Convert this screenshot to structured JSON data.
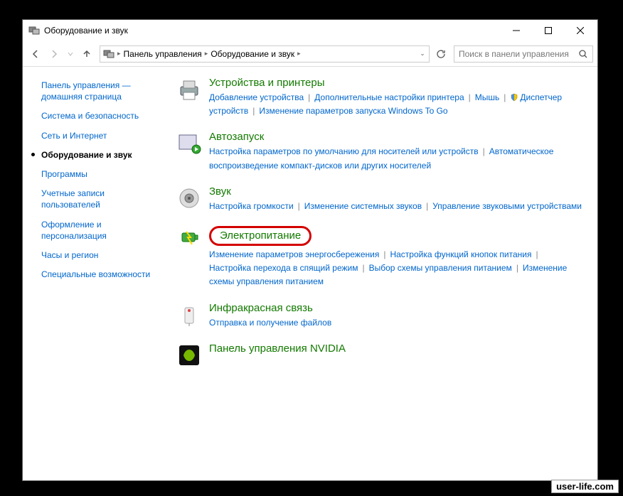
{
  "window": {
    "title": "Оборудование и звук"
  },
  "breadcrumb": {
    "root": "Панель управления",
    "current": "Оборудование и звук"
  },
  "search": {
    "placeholder": "Поиск в панели управления"
  },
  "sidebar": [
    {
      "label": "Панель управления — домашняя страница",
      "active": false
    },
    {
      "label": "Система и безопасность",
      "active": false
    },
    {
      "label": "Сеть и Интернет",
      "active": false
    },
    {
      "label": "Оборудование и звук",
      "active": true
    },
    {
      "label": "Программы",
      "active": false
    },
    {
      "label": "Учетные записи пользователей",
      "active": false
    },
    {
      "label": "Оформление и персонализация",
      "active": false
    },
    {
      "label": "Часы и регион",
      "active": false
    },
    {
      "label": "Специальные возможности",
      "active": false
    }
  ],
  "categories": [
    {
      "icon": "printer",
      "title": "Устройства и принтеры",
      "highlight": false,
      "links": [
        {
          "label": "Добавление устройства",
          "shield": false
        },
        {
          "label": "Дополнительные настройки принтера",
          "shield": false
        },
        {
          "label": "Мышь",
          "shield": false
        },
        {
          "label": "Диспетчер устройств",
          "shield": true
        },
        {
          "label": "Изменение параметров запуска Windows To Go",
          "shield": false
        }
      ]
    },
    {
      "icon": "autoplay",
      "title": "Автозапуск",
      "highlight": false,
      "links": [
        {
          "label": "Настройка параметров по умолчанию для носителей или устройств",
          "shield": false
        },
        {
          "label": "Автоматическое воспроизведение компакт-дисков или других носителей",
          "shield": false
        }
      ]
    },
    {
      "icon": "sound",
      "title": "Звук",
      "highlight": false,
      "links": [
        {
          "label": "Настройка громкости",
          "shield": false
        },
        {
          "label": "Изменение системных звуков",
          "shield": false
        },
        {
          "label": "Управление звуковыми устройствами",
          "shield": false
        }
      ]
    },
    {
      "icon": "power",
      "title": "Электропитание",
      "highlight": true,
      "links": [
        {
          "label": "Изменение параметров энергосбережения",
          "shield": false
        },
        {
          "label": "Настройка функций кнопок питания",
          "shield": false
        },
        {
          "label": "Настройка перехода в спящий режим",
          "shield": false
        },
        {
          "label": "Выбор схемы управления питанием",
          "shield": false
        },
        {
          "label": "Изменение схемы управления питанием",
          "shield": false
        }
      ]
    },
    {
      "icon": "infrared",
      "title": "Инфракрасная связь",
      "highlight": false,
      "links": [
        {
          "label": "Отправка и получение файлов",
          "shield": false
        }
      ]
    },
    {
      "icon": "nvidia",
      "title": "Панель управления NVIDIA",
      "highlight": false,
      "links": []
    }
  ],
  "watermark": "user-life.com"
}
